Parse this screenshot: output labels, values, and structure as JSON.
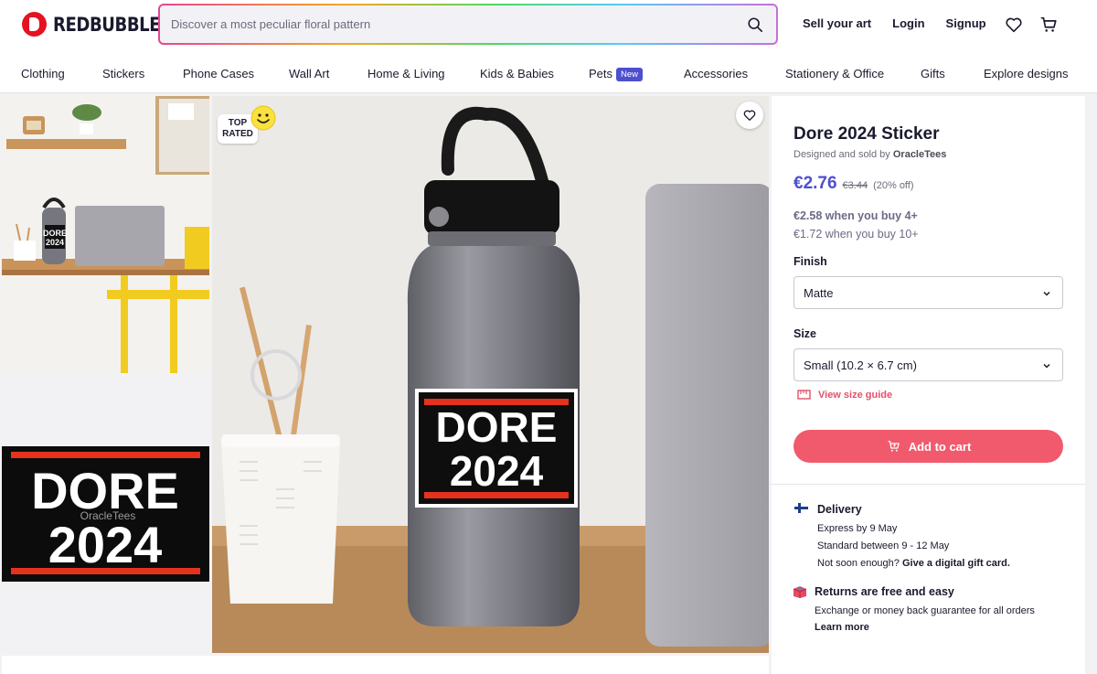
{
  "brand": {
    "name": "REDBUBBLE",
    "color": "#e41321"
  },
  "search": {
    "placeholder": "Discover a most peculiar floral pattern"
  },
  "header_links": {
    "sell": "Sell your art",
    "login": "Login",
    "signup": "Signup"
  },
  "header_icons": [
    "search-icon",
    "heart-icon",
    "cart-icon"
  ],
  "categories": [
    "Clothing",
    "Stickers",
    "Phone Cases",
    "Wall Art",
    "Home & Living",
    "Kids & Babies",
    "Pets",
    "Accessories",
    "Stationery & Office",
    "Gifts",
    "Explore designs"
  ],
  "pets_badge": "New",
  "gallery": {
    "badge_line1": "TOP",
    "badge_line2": "RATED",
    "thumb_sticker_line1": "DORE",
    "thumb_sticker_line2": "2024",
    "thumb_watermark": "OracleTees",
    "thumb1_sticker_line1": "DORE",
    "thumb1_sticker_line2": "2024",
    "main_sticker_line1": "DORE",
    "main_sticker_line2": "2024"
  },
  "product": {
    "title": "Dore 2024 Sticker",
    "designed_prefix": "Designed and sold by",
    "designer": "OracleTees",
    "price": "€2.76",
    "old_price": "€3.44",
    "discount": "(20% off)",
    "bulk_4": "€2.58 when you buy 4+",
    "bulk_10": "€1.72 when you buy 10+",
    "finish_label": "Finish",
    "finish_value": "Matte",
    "size_label": "Size",
    "size_value": "Small (10.2 × 6.7 cm)",
    "size_guide": "View size guide",
    "add_to_cart": "Add to cart",
    "accent_color": "#4e4fcf",
    "cart_color": "#f15a6c"
  },
  "delivery": {
    "title": "Delivery",
    "express": "Express by 9 May",
    "standard": "Standard between 9 - 12 May",
    "not_soon": "Not soon enough?",
    "gift_link": "Give a digital gift card."
  },
  "returns": {
    "title": "Returns are free and easy",
    "text": "Exchange or money back guarantee for all orders",
    "link": "Learn more"
  }
}
